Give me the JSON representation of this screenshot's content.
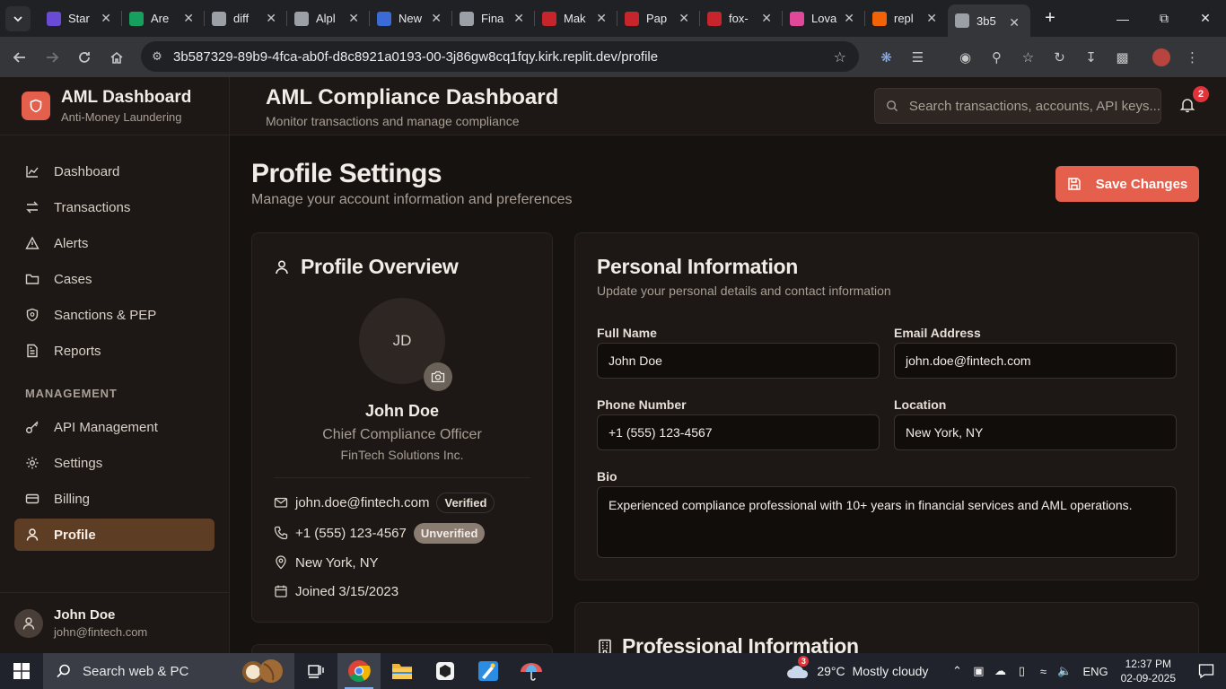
{
  "browser": {
    "tabs": [
      {
        "title": "Star",
        "color": "#6a4bd6"
      },
      {
        "title": "Are",
        "color": "#17a05d"
      },
      {
        "title": "diff",
        "color": "#9aa0a6"
      },
      {
        "title": "Alpl",
        "color": "#9aa0a6"
      },
      {
        "title": "New",
        "color": "#3b6bd6"
      },
      {
        "title": "Fina",
        "color": "#9aa0a6"
      },
      {
        "title": "Mak",
        "color": "#c5252b"
      },
      {
        "title": "Pap",
        "color": "#c5252b"
      },
      {
        "title": "fox-",
        "color": "#c5252b"
      },
      {
        "title": "Lova",
        "color": "#e0489a"
      },
      {
        "title": "repl",
        "color": "#f26207"
      },
      {
        "title": "3b5",
        "color": "#9aa0a6"
      }
    ],
    "url": "3b587329-89b9-4fca-ab0f-d8c8921a0193-00-3j86gw8cq1fqy.kirk.replit.dev/profile"
  },
  "sidebar": {
    "title": "AML Dashboard",
    "subtitle": "Anti-Money Laundering",
    "items": [
      {
        "label": "Dashboard"
      },
      {
        "label": "Transactions"
      },
      {
        "label": "Alerts"
      },
      {
        "label": "Cases"
      },
      {
        "label": "Sanctions & PEP"
      },
      {
        "label": "Reports"
      }
    ],
    "section_label": "MANAGEMENT",
    "mgmt_items": [
      {
        "label": "API Management"
      },
      {
        "label": "Settings"
      },
      {
        "label": "Billing"
      },
      {
        "label": "Profile"
      }
    ],
    "user": {
      "name": "John Doe",
      "email": "john@fintech.com"
    }
  },
  "header": {
    "title": "AML Compliance Dashboard",
    "subtitle": "Monitor transactions and manage compliance",
    "search_placeholder": "Search transactions, accounts, API keys...",
    "notification_count": "2"
  },
  "page": {
    "title": "Profile Settings",
    "subtitle": "Manage your account information and preferences",
    "save_label": "Save Changes"
  },
  "overview": {
    "title": "Profile Overview",
    "initials": "JD",
    "name": "John Doe",
    "role": "Chief Compliance Officer",
    "company": "FinTech Solutions Inc.",
    "email": "john.doe@fintech.com",
    "email_badge": "Verified",
    "phone": "+1 (555) 123-4567",
    "phone_badge": "Unverified",
    "location": "New York, NY",
    "joined": "Joined 3/15/2023"
  },
  "personal": {
    "title": "Personal Information",
    "subtitle": "Update your personal details and contact information",
    "full_name_label": "Full Name",
    "full_name": "John Doe",
    "email_label": "Email Address",
    "email": "john.doe@fintech.com",
    "phone_label": "Phone Number",
    "phone": "+1 (555) 123-4567",
    "location_label": "Location",
    "location": "New York, NY",
    "bio_label": "Bio",
    "bio": "Experienced compliance professional with 10+ years in financial services and AML operations."
  },
  "professional": {
    "title": "Professional Information"
  },
  "taskbar": {
    "search_text": "Search web & PC",
    "weather_badge": "3",
    "temperature": "29°C",
    "condition": "Mostly cloudy",
    "language": "ENG",
    "time": "12:37 PM",
    "date": "02-09-2025"
  }
}
